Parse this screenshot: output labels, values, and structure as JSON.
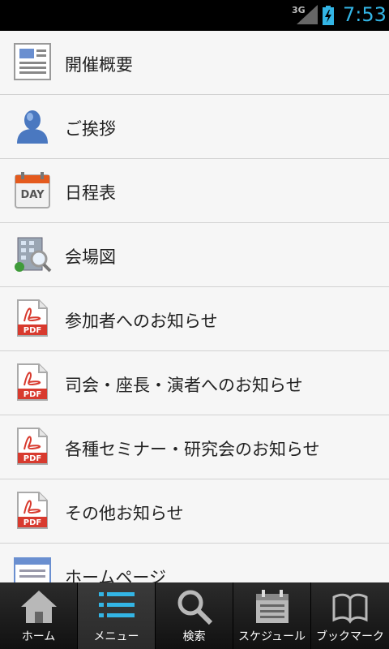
{
  "status_bar": {
    "network": "3G",
    "time": "7:53",
    "accent": "#33b5e5"
  },
  "menu_list": [
    {
      "label": "開催概要",
      "icon": "document-icon"
    },
    {
      "label": "ご挨拶",
      "icon": "person-icon"
    },
    {
      "label": "日程表",
      "icon": "calendar-day-icon"
    },
    {
      "label": "会場図",
      "icon": "building-search-icon"
    },
    {
      "label": "参加者へのお知らせ",
      "icon": "pdf-icon"
    },
    {
      "label": "司会・座長・演者へのお知らせ",
      "icon": "pdf-icon"
    },
    {
      "label": "各種セミナー・研究会のお知らせ",
      "icon": "pdf-icon"
    },
    {
      "label": "その他お知らせ",
      "icon": "pdf-icon"
    },
    {
      "label": "ホームページ",
      "icon": "webpage-icon"
    }
  ],
  "tab_bar": {
    "active": "メニュー",
    "tabs": [
      {
        "label": "ホーム",
        "icon": "home-icon"
      },
      {
        "label": "メニュー",
        "icon": "list-icon"
      },
      {
        "label": "検索",
        "icon": "search-icon"
      },
      {
        "label": "スケジュール",
        "icon": "calendar-icon"
      },
      {
        "label": "ブックマーク",
        "icon": "book-icon"
      }
    ]
  },
  "icon_glyph_text": {
    "day": "DAY",
    "pdf": "PDF"
  }
}
